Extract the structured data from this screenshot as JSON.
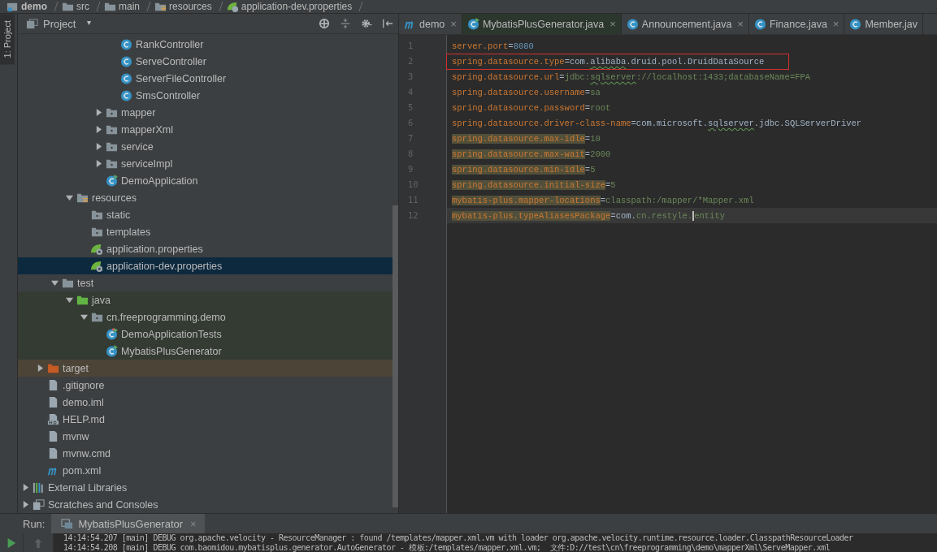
{
  "breadcrumbs": [
    {
      "label": "demo",
      "kind": "module"
    },
    {
      "label": "src",
      "kind": "folder"
    },
    {
      "label": "main",
      "kind": "folder"
    },
    {
      "label": "resources",
      "kind": "resources-folder"
    },
    {
      "label": "application-dev.properties",
      "kind": "spring-config"
    }
  ],
  "side_strip": {
    "label": "1: Project"
  },
  "project_panel": {
    "title": "Project",
    "caret": "▾"
  },
  "tree": [
    {
      "children": [
        {
          "children": [
            {
              "children": [
                {
                  "children": [
                    {
                      "children": [
                        {
                          "children": [
                            {
                              "label": "RankController",
                              "kind": "class",
                              "in_tests": false,
                              "excluded": false,
                              "selected": false
                            },
                            {
                              "label": "ServeController",
                              "kind": "class",
                              "in_tests": false,
                              "excluded": false,
                              "selected": false
                            },
                            {
                              "label": "ServerFileController",
                              "kind": "class",
                              "in_tests": false,
                              "excluded": false,
                              "selected": false
                            },
                            {
                              "label": "SmsController",
                              "kind": "class",
                              "in_tests": false,
                              "excluded": false,
                              "selected": false
                            }
                          ]
                        },
                        {
                          "label": "mapper",
                          "kind": "folder",
                          "in_tests": false,
                          "excluded": false,
                          "selected": false,
                          "expanded": false
                        },
                        {
                          "label": "mapperXml",
                          "kind": "folder",
                          "in_tests": false,
                          "excluded": false,
                          "selected": false,
                          "expanded": false
                        },
                        {
                          "label": "service",
                          "kind": "folder",
                          "in_tests": false,
                          "excluded": false,
                          "selected": false,
                          "expanded": false
                        },
                        {
                          "label": "serviceImpl",
                          "kind": "folder",
                          "in_tests": false,
                          "excluded": false,
                          "selected": false,
                          "expanded": false
                        },
                        {
                          "label": "DemoApplication",
                          "kind": "spring-class",
                          "in_tests": false,
                          "excluded": false,
                          "selected": false
                        }
                      ]
                    }
                  ]
                },
                {
                  "label": "resources",
                  "kind": "resources-folder",
                  "in_tests": false,
                  "excluded": false,
                  "selected": false,
                  "expanded": true,
                  "children": [
                    {
                      "label": "static",
                      "kind": "folder",
                      "in_tests": false,
                      "excluded": false,
                      "selected": false
                    },
                    {
                      "label": "templates",
                      "kind": "folder",
                      "in_tests": false,
                      "excluded": false,
                      "selected": false
                    },
                    {
                      "label": "application.properties",
                      "kind": "spring-config",
                      "in_tests": false,
                      "excluded": false,
                      "selected": false
                    },
                    {
                      "label": "application-dev.properties",
                      "kind": "spring-config",
                      "in_tests": false,
                      "excluded": false,
                      "selected": true
                    }
                  ]
                }
              ]
            },
            {
              "label": "test",
              "kind": "folder",
              "in_tests": false,
              "excluded": false,
              "selected": false,
              "expanded": true,
              "children": [
                {
                  "label": "java",
                  "kind": "test-source-folder",
                  "in_tests": true,
                  "excluded": false,
                  "selected": false,
                  "expanded": true,
                  "children": [
                    {
                      "label": "cn.freeprogramming.demo",
                      "kind": "package",
                      "in_tests": true,
                      "excluded": false,
                      "selected": false,
                      "expanded": true,
                      "children": [
                        {
                          "label": "DemoApplicationTests",
                          "kind": "test-class",
                          "in_tests": true,
                          "excluded": false,
                          "selected": false
                        },
                        {
                          "label": "MybatisPlusGenerator",
                          "kind": "runnable-class",
                          "in_tests": true,
                          "excluded": false,
                          "selected": false
                        }
                      ]
                    }
                  ]
                }
              ]
            }
          ]
        },
        {
          "label": "target",
          "kind": "excluded-folder",
          "in_tests": false,
          "excluded": true,
          "selected": false,
          "expanded": false
        },
        {
          "label": ".gitignore",
          "kind": "file",
          "in_tests": false,
          "excluded": false,
          "selected": false
        },
        {
          "label": "demo.iml",
          "kind": "file",
          "in_tests": false,
          "excluded": false,
          "selected": false
        },
        {
          "label": "HELP.md",
          "kind": "markdown",
          "in_tests": false,
          "excluded": false,
          "selected": false
        },
        {
          "label": "mvnw",
          "kind": "file",
          "in_tests": false,
          "excluded": false,
          "selected": false
        },
        {
          "label": "mvnw.cmd",
          "kind": "file",
          "in_tests": false,
          "excluded": false,
          "selected": false
        },
        {
          "label": "pom.xml",
          "kind": "maven",
          "in_tests": false,
          "excluded": false,
          "selected": false
        }
      ]
    },
    {
      "label": "External Libraries",
      "kind": "libraries",
      "in_tests": false,
      "excluded": false,
      "selected": false,
      "expanded": false
    },
    {
      "label": "Scratches and Consoles",
      "kind": "scratches",
      "in_tests": false,
      "excluded": false,
      "selected": false,
      "expanded": false
    }
  ],
  "editor_tabs": [
    {
      "label": "demo",
      "kind": "maven",
      "selected": false,
      "close": "×"
    },
    {
      "label": "MybatisPlusGenerator.java",
      "kind": "runnable-class",
      "selected": true,
      "close": "×"
    },
    {
      "label": "Announcement.java",
      "kind": "class",
      "selected": false,
      "close": "×"
    },
    {
      "label": "Finance.java",
      "kind": "class",
      "selected": false,
      "close": "×"
    },
    {
      "label": "Member.jav",
      "kind": "class",
      "selected": false
    }
  ],
  "editor_lines": [
    {
      "number": "1",
      "boxed": false,
      "warning": false,
      "current": false,
      "segments": [
        {
          "t": "server.port",
          "kind": "key"
        },
        {
          "t": "=",
          "kind": "sep"
        },
        {
          "t": "8080",
          "kind": "number"
        }
      ]
    },
    {
      "number": "2",
      "boxed": true,
      "warning": false,
      "current": false,
      "segments": [
        {
          "t": "spring.datasource.type",
          "kind": "key"
        },
        {
          "t": "=",
          "kind": "sep"
        },
        {
          "t": "com.",
          "kind": "ref"
        },
        {
          "t": "alibaba",
          "kind": "ref",
          "typo": true
        },
        {
          "t": ".druid.pool.DruidDataSource",
          "kind": "ref"
        }
      ]
    },
    {
      "number": "3",
      "boxed": false,
      "warning": false,
      "current": false,
      "segments": [
        {
          "t": "spring.datasource.url",
          "kind": "key"
        },
        {
          "t": "=",
          "kind": "sep"
        },
        {
          "t": "jdbc:",
          "kind": "value"
        },
        {
          "t": "sqlserver",
          "kind": "value",
          "typo": true
        },
        {
          "t": "://localhost:1433;databaseName=FPA",
          "kind": "value"
        }
      ]
    },
    {
      "number": "4",
      "boxed": false,
      "warning": false,
      "current": false,
      "segments": [
        {
          "t": "spring.datasource.username",
          "kind": "key"
        },
        {
          "t": "=",
          "kind": "sep"
        },
        {
          "t": "sa",
          "kind": "value"
        }
      ]
    },
    {
      "number": "5",
      "boxed": false,
      "warning": false,
      "current": false,
      "segments": [
        {
          "t": "spring.datasource.password",
          "kind": "key"
        },
        {
          "t": "=",
          "kind": "sep"
        },
        {
          "t": "root",
          "kind": "value"
        }
      ]
    },
    {
      "number": "6",
      "boxed": false,
      "warning": false,
      "current": false,
      "segments": [
        {
          "t": "spring.datasource.driver-class-name",
          "kind": "key"
        },
        {
          "t": "=",
          "kind": "sep"
        },
        {
          "t": "com.microsoft.",
          "kind": "ref"
        },
        {
          "t": "sqlserver",
          "kind": "ref",
          "typo": true
        },
        {
          "t": ".jdbc.SQLServerDriver",
          "kind": "ref"
        }
      ]
    },
    {
      "number": "7",
      "boxed": false,
      "warning": true,
      "current": false,
      "segments": [
        {
          "t": "spring.datasource.max-idle",
          "kind": "key"
        },
        {
          "t": "=",
          "kind": "sep"
        },
        {
          "t": "10",
          "kind": "value"
        }
      ]
    },
    {
      "number": "8",
      "boxed": false,
      "warning": true,
      "current": false,
      "segments": [
        {
          "t": "spring.datasource.max-wait",
          "kind": "key"
        },
        {
          "t": "=",
          "kind": "sep"
        },
        {
          "t": "2000",
          "kind": "value"
        }
      ]
    },
    {
      "number": "9",
      "boxed": false,
      "warning": true,
      "current": false,
      "segments": [
        {
          "t": "spring.datasource.min-idle",
          "kind": "key"
        },
        {
          "t": "=",
          "kind": "sep"
        },
        {
          "t": "5",
          "kind": "value"
        }
      ]
    },
    {
      "number": "10",
      "boxed": false,
      "warning": true,
      "current": false,
      "segments": [
        {
          "t": "spring.datasource.initial-size",
          "kind": "key"
        },
        {
          "t": "=",
          "kind": "sep"
        },
        {
          "t": "5",
          "kind": "value"
        }
      ]
    },
    {
      "number": "11",
      "boxed": false,
      "warning": true,
      "current": false,
      "segments": [
        {
          "t": "mybatis-plus.mapper-locations",
          "kind": "key"
        },
        {
          "t": "=",
          "kind": "sep"
        },
        {
          "t": "classpath:/mapper/*Mapper.xml",
          "kind": "value"
        }
      ]
    },
    {
      "number": "12",
      "boxed": false,
      "warning": true,
      "current": true,
      "segments": [
        {
          "t": "mybatis-plus.typeAliasesPackage",
          "kind": "key"
        },
        {
          "t": "=",
          "kind": "sep"
        },
        {
          "t": "com.",
          "kind": "ref"
        },
        {
          "t": "cn.restyle.",
          "kind": "value"
        },
        {
          "t": "entity",
          "kind": "value",
          "caret": true
        }
      ]
    }
  ],
  "run_panel": {
    "label": "Run:",
    "tab": {
      "label": "MybatisPlusGenerator",
      "close": "×"
    },
    "console_lines": [
      "14:14:54.207 [main] DEBUG org.apache.velocity - ResourceManager : found /templates/mapper.xml.vm with loader org.apache.velocity.runtime.resource.loader.ClasspathResourceLoader",
      "14:14:54.208 [main] DEBUG com.baomidou.mybatisplus.generator.AutoGenerator - 模板:/templates/mapper.xml.vm;  文件:D://test\\cn\\freeprogramming\\demo\\mapperXml\\ServeMapper.xml"
    ]
  }
}
